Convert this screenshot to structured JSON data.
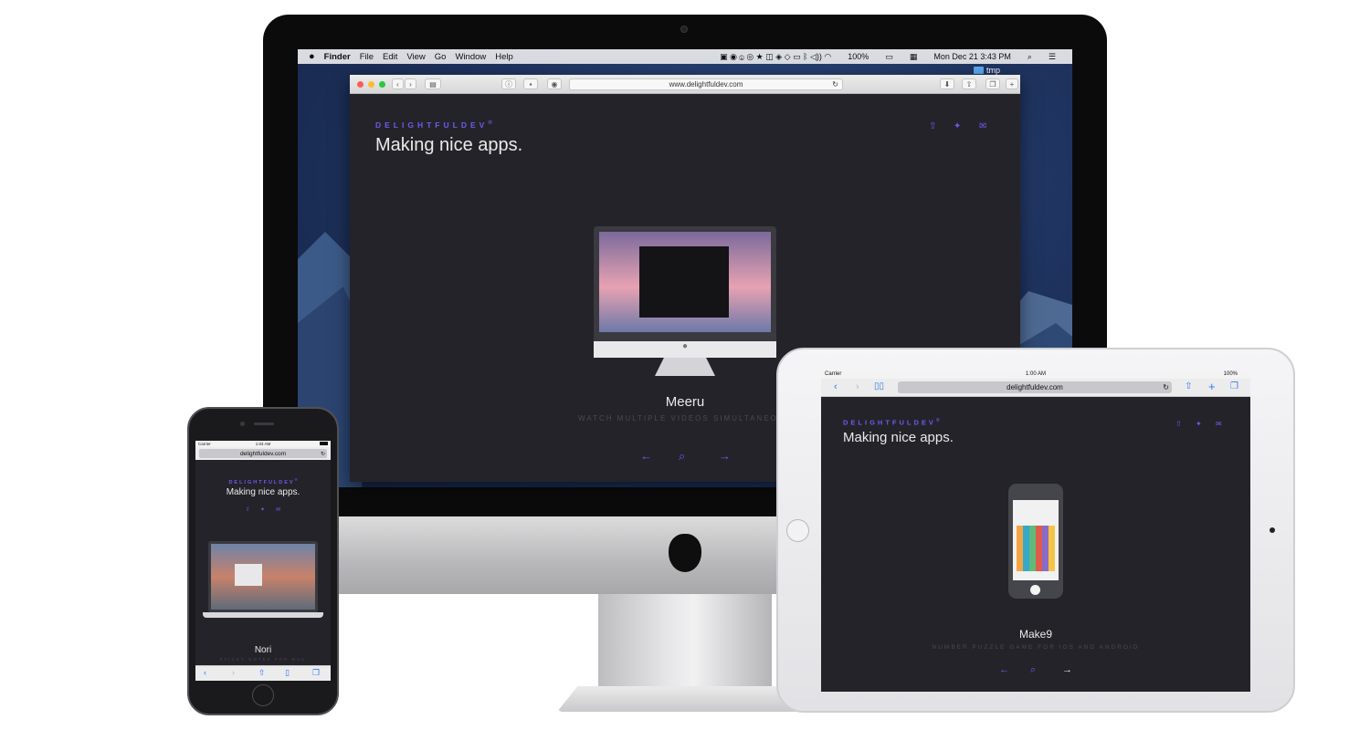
{
  "mac": {
    "menubar": {
      "apple": "",
      "items": [
        "Finder",
        "File",
        "Edit",
        "View",
        "Go",
        "Window",
        "Help"
      ],
      "battery": "100%",
      "datetime": "Mon Dec 21  3:43 PM"
    },
    "desktop_folder": "tmp",
    "safari_url": "www.delightfuldev.com"
  },
  "site": {
    "brand": "DELIGHTFULDEV",
    "brand_mark": "®",
    "tagline": "Making nice apps."
  },
  "desktop_page": {
    "app_name": "Meeru",
    "app_desc": "WATCH MULTIPLE VIDEOS SIMULTANEOUS"
  },
  "ipad": {
    "carrier": "Carrier",
    "time": "1:00 AM",
    "battery": "100%",
    "url": "delightfuldev.com",
    "app_name": "Make9",
    "app_desc": "NUMBER PUZZLE GAME FOR IOS AND ANDROID"
  },
  "iphone": {
    "carrier": "Carrier",
    "time": "1:04 AM",
    "url": "delightfuldev.com",
    "app_name": "Nori",
    "app_desc": "STICKY NOTES FOR MAC"
  },
  "icons": {
    "prev": "←",
    "next": "→",
    "search": "⌕",
    "share": "⇧",
    "twitter": "✦",
    "email": "✉"
  },
  "colors": {
    "accent": "#6b5cf0",
    "page_bg": "#242329"
  }
}
